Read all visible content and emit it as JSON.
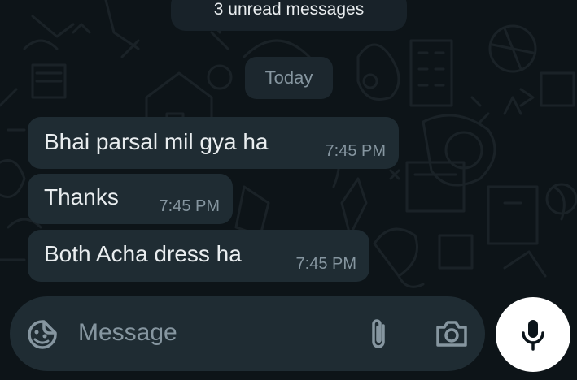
{
  "banner": {
    "unread_text": "3 unread messages"
  },
  "date_divider": {
    "label": "Today"
  },
  "messages": [
    {
      "text": "Bhai parsal mil gya ha",
      "time": "7:45 PM"
    },
    {
      "text": "Thanks",
      "time": "7:45 PM"
    },
    {
      "text": "Both Acha dress ha",
      "time": "7:45 PM"
    }
  ],
  "composer": {
    "placeholder": "Message",
    "icons": [
      "sticker-icon",
      "attach-icon",
      "camera-icon"
    ]
  },
  "mic": {
    "icon": "microphone-icon"
  },
  "colors": {
    "background": "#0d1418",
    "bubble": "#1f2c33",
    "text": "#e9edef",
    "muted": "#8696a0",
    "mic_button": "#ffffff"
  }
}
